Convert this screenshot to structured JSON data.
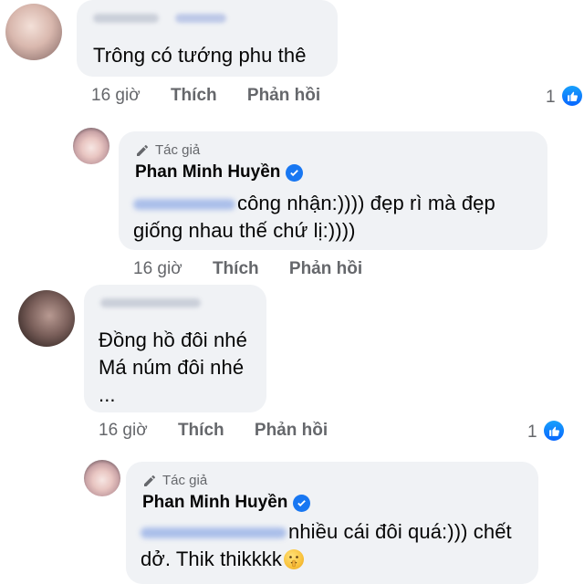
{
  "comments": [
    {
      "text": "Trông có tướng phu thê",
      "time": "16 giờ",
      "like_action": "Thích",
      "reply_action": "Phản hồi",
      "reaction_count": "1",
      "reply": {
        "author_tag": "Tác giả",
        "author_name": "Phan Minh Huyền",
        "text_line1": "công nhận:)))) đẹp rì mà đẹp",
        "text_line2": "giống nhau thế chứ lị:))))",
        "time": "16 giờ",
        "like_action": "Thích",
        "reply_action": "Phản hồi"
      }
    },
    {
      "text_line1": "Đồng hồ đôi nhé",
      "text_line2": "Má núm đôi nhé",
      "text_line3": "...",
      "time": "16 giờ",
      "like_action": "Thích",
      "reply_action": "Phản hồi",
      "reaction_count": "1",
      "reply": {
        "author_tag": "Tác giả",
        "author_name": "Phan Minh Huyền",
        "text_line1": "nhiều cái đôi quá:))) chết",
        "text_line2": "dở. Thik thikkkk",
        "emoji": "shushing-face"
      }
    }
  ],
  "colors": {
    "bubble": "#f0f2f5",
    "meta_text": "#65676b",
    "verified": "#1877f2",
    "like_badge": "#0866ff"
  }
}
